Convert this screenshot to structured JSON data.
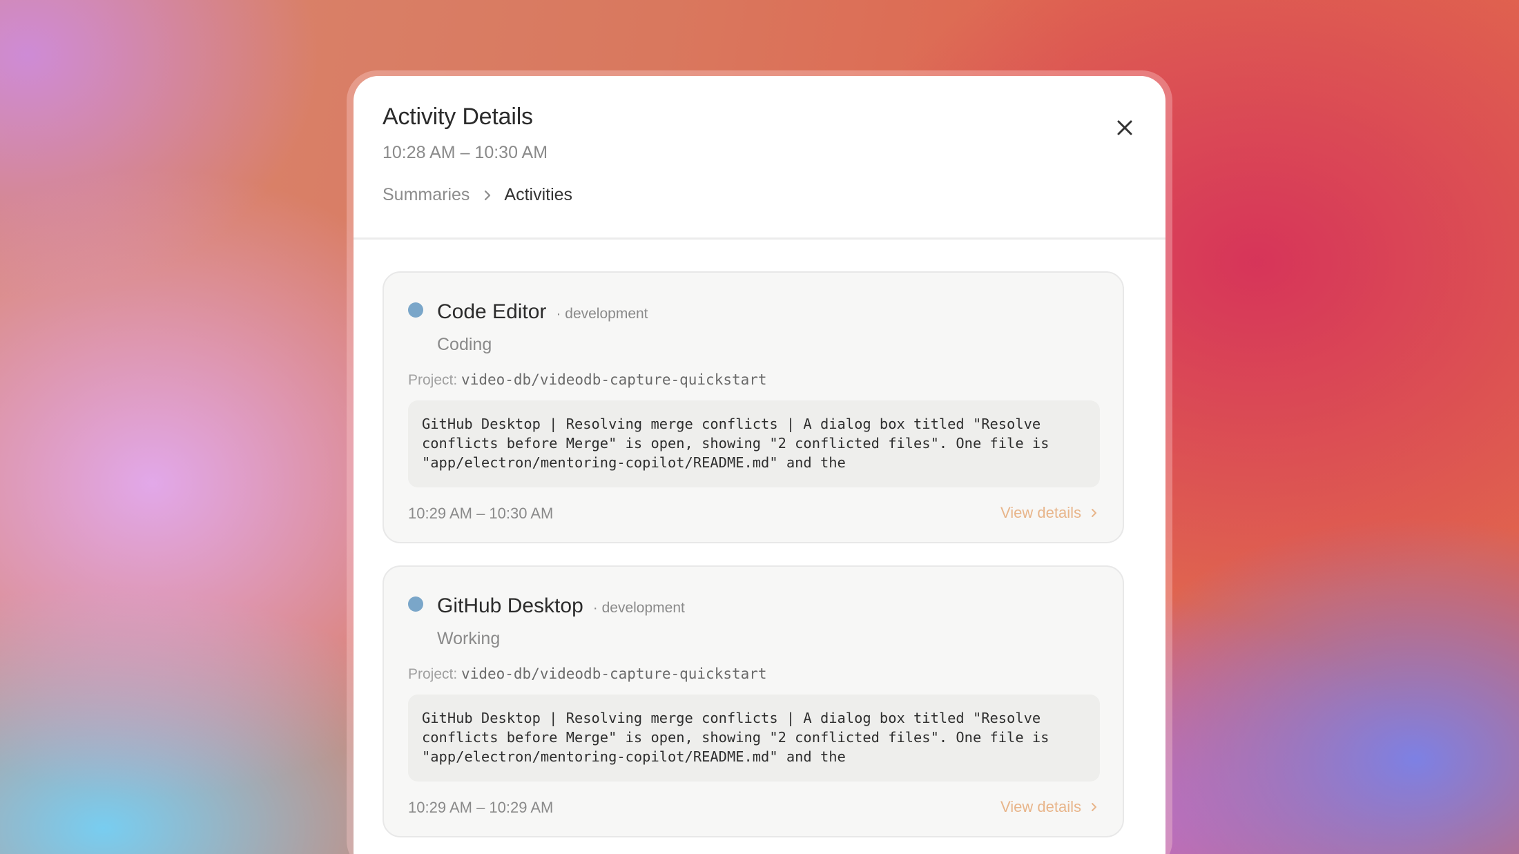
{
  "modal": {
    "title": "Activity Details",
    "time_range": "10:28 AM – 10:30 AM",
    "close_icon": "close-icon",
    "breadcrumb": {
      "parent": "Summaries",
      "separator_icon": "chevron-right-icon",
      "current": "Activities"
    }
  },
  "activities": [
    {
      "app": "Code Editor",
      "category": "· development",
      "state": "Coding",
      "project_label": "Project:",
      "project": "video-db/videodb-capture-quickstart",
      "description": "GitHub Desktop | Resolving merge conflicts | A dialog box titled \"Resolve\nconflicts before Merge\" is open, showing \"2 conflicted files\". One file is\n\"app/electron/mentoring-copilot/README.md\" and the",
      "time": "10:29 AM – 10:30 AM",
      "view_details": "View details",
      "dot_color": "#7aa6c9"
    },
    {
      "app": "GitHub Desktop",
      "category": "· development",
      "state": "Working",
      "project_label": "Project:",
      "project": "video-db/videodb-capture-quickstart",
      "description": "GitHub Desktop | Resolving merge conflicts | A dialog box titled \"Resolve\nconflicts before Merge\" is open, showing \"2 conflicted files\". One file is\n\"app/electron/mentoring-copilot/README.md\" and the",
      "time": "10:29 AM – 10:29 AM",
      "view_details": "View details",
      "dot_color": "#7aa6c9"
    }
  ],
  "colors": {
    "accent_link": "#e8b58a",
    "status_dot": "#7aa6c9"
  }
}
